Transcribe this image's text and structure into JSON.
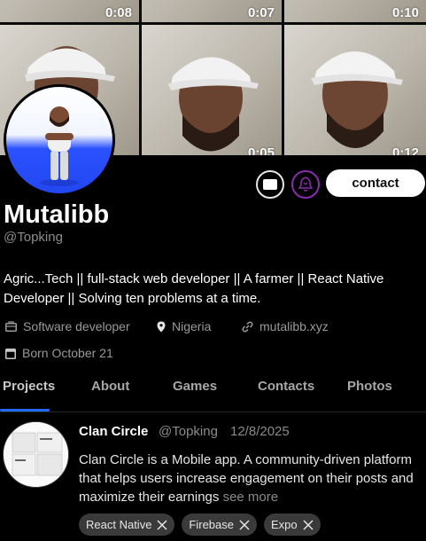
{
  "cover": {
    "videos": [
      {
        "duration": "0:08"
      },
      {
        "duration": "0:07"
      },
      {
        "duration": "0:10"
      },
      {
        "duration": ""
      },
      {
        "duration": "0:05"
      },
      {
        "duration": "0:12"
      }
    ]
  },
  "profile": {
    "name": "Mutalibb",
    "handle": "@Topking",
    "bio": "Agric...Tech || full-stack web developer || A farmer || React Native Developer || Solving ten problems at a time.",
    "job": "Software developer",
    "location": "Nigeria",
    "website": "mutalibb.xyz",
    "born": "Born October 21"
  },
  "actions": {
    "contact_label": "contact",
    "message_icon": "message-icon",
    "subscribe_icon": "bell-subscribe-icon"
  },
  "tabs": [
    {
      "label": "Projects",
      "active": true
    },
    {
      "label": "About",
      "active": false
    },
    {
      "label": "Games",
      "active": false
    },
    {
      "label": "Contacts",
      "active": false
    },
    {
      "label": "Photos",
      "active": false
    }
  ],
  "project": {
    "title": "Clan Circle",
    "handle": "@Topking",
    "date": "12/8/2025",
    "description": "Clan Circle is a Mobile app. A community-driven platform that helps users increase engagement on their posts and maximize their earnings",
    "see_more": "see more",
    "tags": [
      "React Native",
      "Firebase",
      "Expo"
    ]
  },
  "colors": {
    "background": "#000000",
    "accent_tab": "#1f6aff",
    "subscribe_ring": "#8a2bb0",
    "chip_bg": "#3a3a3a"
  }
}
